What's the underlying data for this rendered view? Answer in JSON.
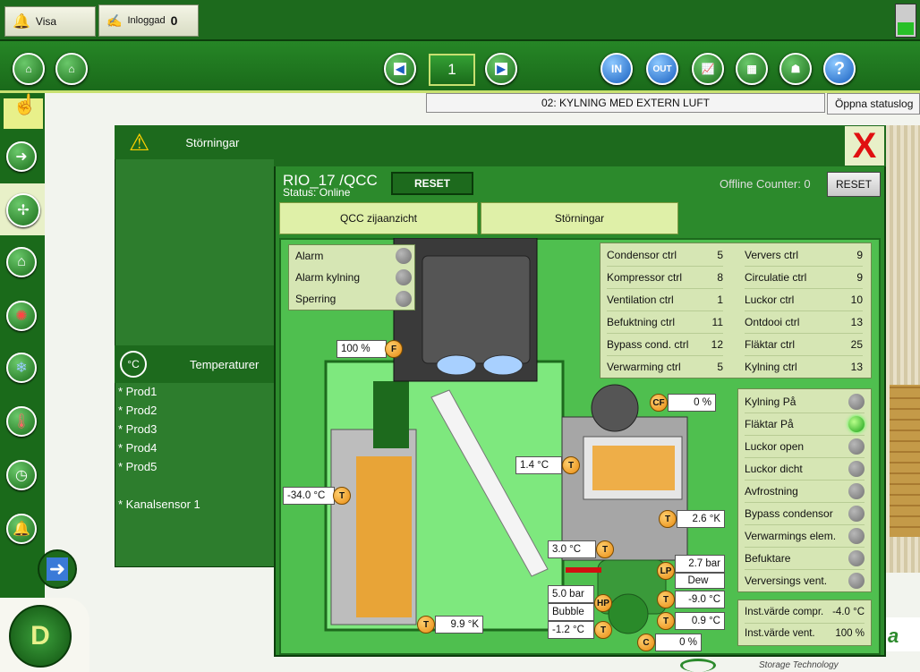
{
  "topbar": {
    "visa_label": "Visa",
    "inloggad_label": "Inloggad",
    "inloggad_count": "0"
  },
  "iconbar": {
    "page_number": "1",
    "in_label": "IN",
    "out_label": "OUT",
    "help_label": "?"
  },
  "status_bar": {
    "text": "02: KYLNING MED EXTERN LUFT",
    "button_label": "Öppna statuslog"
  },
  "panels": {
    "storningar_title": "Störningar",
    "temperatur_title": "Temperaturer",
    "temperature_items": [
      "* Prod1",
      "* Prod2",
      "* Prod3",
      "* Prod4",
      "* Prod5",
      "",
      "* Kanalsensor 1"
    ]
  },
  "dialog": {
    "title": "RIO_17 /QCC",
    "status": "Status: Online",
    "reset_label": "RESET",
    "offline_label": "Offline Counter: 0",
    "offline_reset_label": "RESET",
    "close_label": "X",
    "tabs": [
      "QCC zijaanzicht",
      "Störningar"
    ],
    "alarms": [
      "Alarm",
      "Alarm kylning",
      "Sperring"
    ],
    "ctrl_left": [
      {
        "name": "Condensor ctrl",
        "value": "5"
      },
      {
        "name": "Kompressor ctrl",
        "value": "8"
      },
      {
        "name": "Ventilation ctrl",
        "value": "1"
      },
      {
        "name": "Befuktning ctrl",
        "value": "11"
      },
      {
        "name": "Bypass cond. ctrl",
        "value": "12"
      },
      {
        "name": "Verwarming ctrl",
        "value": "5"
      }
    ],
    "ctrl_right": [
      {
        "name": "Ververs ctrl",
        "value": "9"
      },
      {
        "name": "Circulatie ctrl",
        "value": "9"
      },
      {
        "name": "Luckor ctrl",
        "value": "10"
      },
      {
        "name": "Ontdooi ctrl",
        "value": "13"
      },
      {
        "name": "Fläktar ctrl",
        "value": "25"
      },
      {
        "name": "Kylning ctrl",
        "value": "13"
      }
    ],
    "states": [
      {
        "name": "Kylning På",
        "on": false
      },
      {
        "name": "Fläktar På",
        "on": true
      },
      {
        "name": "Luckor open",
        "on": false
      },
      {
        "name": "Luckor dicht",
        "on": false
      },
      {
        "name": "Avfrostning",
        "on": false
      },
      {
        "name": "Bypass condensor",
        "on": false
      },
      {
        "name": "Verwarmings elem.",
        "on": false
      },
      {
        "name": "Befuktare",
        "on": false
      },
      {
        "name": "Verversings vent.",
        "on": false
      }
    ],
    "instvarde": [
      {
        "name": "Inst.värde compr.",
        "value": "-4.0 °C"
      },
      {
        "name": "Inst.värde vent.",
        "value": "100 %"
      }
    ],
    "readings": {
      "fan_pct": "100 %",
      "cf_pct": "0 %",
      "temp_left": "-34.0 °C",
      "temp_mid": "1.4 °C",
      "temp_cond": "2.6 °K",
      "temp_bottom": "9.9 °K",
      "temp_3": "3.0 °C",
      "lp_bar": "2.7 bar",
      "lp_label": "Dew",
      "hp_bar": "5.0 bar",
      "hp_label": "Bubble",
      "temp_neg12": "-1.2 °C",
      "temp_neg9": "-9.0 °C",
      "temp_09": "0.9 °C",
      "c_pct": "0 %"
    },
    "badges": {
      "f": "F",
      "t": "T",
      "cf": "CF",
      "lp": "LP",
      "hp": "HP",
      "c": "C"
    }
  },
  "brand": {
    "tagline": "Storage Technology"
  },
  "colors": {
    "accent_green": "#1d6a1d",
    "light_green": "#dff0a8",
    "orange": "#e88a10"
  }
}
